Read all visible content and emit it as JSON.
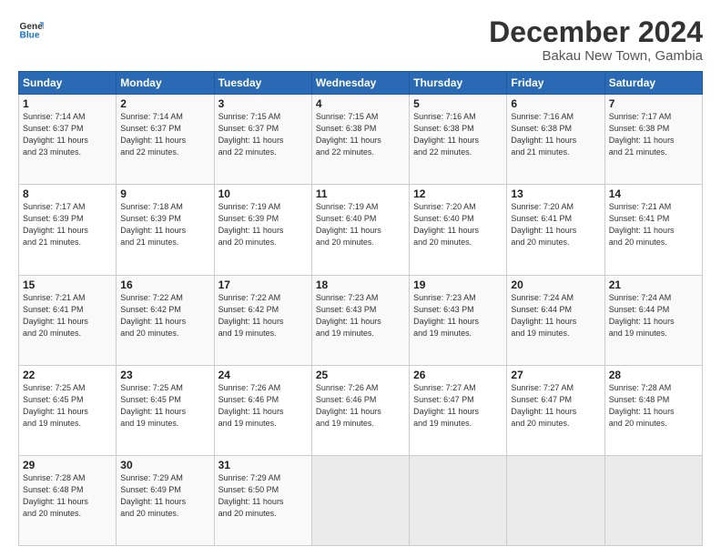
{
  "header": {
    "logo_line1": "General",
    "logo_line2": "Blue",
    "month": "December 2024",
    "location": "Bakau New Town, Gambia"
  },
  "days_of_week": [
    "Sunday",
    "Monday",
    "Tuesday",
    "Wednesday",
    "Thursday",
    "Friday",
    "Saturday"
  ],
  "weeks": [
    [
      {
        "day": "1",
        "info": "Sunrise: 7:14 AM\nSunset: 6:37 PM\nDaylight: 11 hours\nand 23 minutes."
      },
      {
        "day": "2",
        "info": "Sunrise: 7:14 AM\nSunset: 6:37 PM\nDaylight: 11 hours\nand 22 minutes."
      },
      {
        "day": "3",
        "info": "Sunrise: 7:15 AM\nSunset: 6:37 PM\nDaylight: 11 hours\nand 22 minutes."
      },
      {
        "day": "4",
        "info": "Sunrise: 7:15 AM\nSunset: 6:38 PM\nDaylight: 11 hours\nand 22 minutes."
      },
      {
        "day": "5",
        "info": "Sunrise: 7:16 AM\nSunset: 6:38 PM\nDaylight: 11 hours\nand 22 minutes."
      },
      {
        "day": "6",
        "info": "Sunrise: 7:16 AM\nSunset: 6:38 PM\nDaylight: 11 hours\nand 21 minutes."
      },
      {
        "day": "7",
        "info": "Sunrise: 7:17 AM\nSunset: 6:38 PM\nDaylight: 11 hours\nand 21 minutes."
      }
    ],
    [
      {
        "day": "8",
        "info": "Sunrise: 7:17 AM\nSunset: 6:39 PM\nDaylight: 11 hours\nand 21 minutes."
      },
      {
        "day": "9",
        "info": "Sunrise: 7:18 AM\nSunset: 6:39 PM\nDaylight: 11 hours\nand 21 minutes."
      },
      {
        "day": "10",
        "info": "Sunrise: 7:19 AM\nSunset: 6:39 PM\nDaylight: 11 hours\nand 20 minutes."
      },
      {
        "day": "11",
        "info": "Sunrise: 7:19 AM\nSunset: 6:40 PM\nDaylight: 11 hours\nand 20 minutes."
      },
      {
        "day": "12",
        "info": "Sunrise: 7:20 AM\nSunset: 6:40 PM\nDaylight: 11 hours\nand 20 minutes."
      },
      {
        "day": "13",
        "info": "Sunrise: 7:20 AM\nSunset: 6:41 PM\nDaylight: 11 hours\nand 20 minutes."
      },
      {
        "day": "14",
        "info": "Sunrise: 7:21 AM\nSunset: 6:41 PM\nDaylight: 11 hours\nand 20 minutes."
      }
    ],
    [
      {
        "day": "15",
        "info": "Sunrise: 7:21 AM\nSunset: 6:41 PM\nDaylight: 11 hours\nand 20 minutes."
      },
      {
        "day": "16",
        "info": "Sunrise: 7:22 AM\nSunset: 6:42 PM\nDaylight: 11 hours\nand 20 minutes."
      },
      {
        "day": "17",
        "info": "Sunrise: 7:22 AM\nSunset: 6:42 PM\nDaylight: 11 hours\nand 19 minutes."
      },
      {
        "day": "18",
        "info": "Sunrise: 7:23 AM\nSunset: 6:43 PM\nDaylight: 11 hours\nand 19 minutes."
      },
      {
        "day": "19",
        "info": "Sunrise: 7:23 AM\nSunset: 6:43 PM\nDaylight: 11 hours\nand 19 minutes."
      },
      {
        "day": "20",
        "info": "Sunrise: 7:24 AM\nSunset: 6:44 PM\nDaylight: 11 hours\nand 19 minutes."
      },
      {
        "day": "21",
        "info": "Sunrise: 7:24 AM\nSunset: 6:44 PM\nDaylight: 11 hours\nand 19 minutes."
      }
    ],
    [
      {
        "day": "22",
        "info": "Sunrise: 7:25 AM\nSunset: 6:45 PM\nDaylight: 11 hours\nand 19 minutes."
      },
      {
        "day": "23",
        "info": "Sunrise: 7:25 AM\nSunset: 6:45 PM\nDaylight: 11 hours\nand 19 minutes."
      },
      {
        "day": "24",
        "info": "Sunrise: 7:26 AM\nSunset: 6:46 PM\nDaylight: 11 hours\nand 19 minutes."
      },
      {
        "day": "25",
        "info": "Sunrise: 7:26 AM\nSunset: 6:46 PM\nDaylight: 11 hours\nand 19 minutes."
      },
      {
        "day": "26",
        "info": "Sunrise: 7:27 AM\nSunset: 6:47 PM\nDaylight: 11 hours\nand 19 minutes."
      },
      {
        "day": "27",
        "info": "Sunrise: 7:27 AM\nSunset: 6:47 PM\nDaylight: 11 hours\nand 20 minutes."
      },
      {
        "day": "28",
        "info": "Sunrise: 7:28 AM\nSunset: 6:48 PM\nDaylight: 11 hours\nand 20 minutes."
      }
    ],
    [
      {
        "day": "29",
        "info": "Sunrise: 7:28 AM\nSunset: 6:48 PM\nDaylight: 11 hours\nand 20 minutes."
      },
      {
        "day": "30",
        "info": "Sunrise: 7:29 AM\nSunset: 6:49 PM\nDaylight: 11 hours\nand 20 minutes."
      },
      {
        "day": "31",
        "info": "Sunrise: 7:29 AM\nSunset: 6:50 PM\nDaylight: 11 hours\nand 20 minutes."
      },
      {
        "day": "",
        "info": ""
      },
      {
        "day": "",
        "info": ""
      },
      {
        "day": "",
        "info": ""
      },
      {
        "day": "",
        "info": ""
      }
    ]
  ]
}
